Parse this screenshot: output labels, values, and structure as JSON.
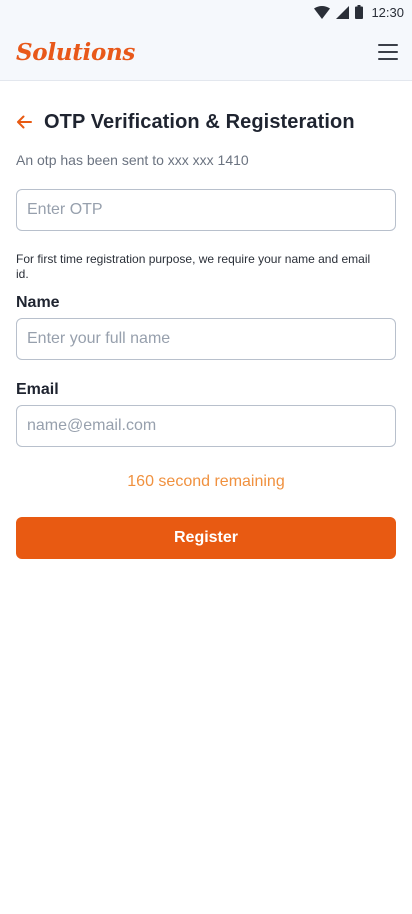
{
  "status_bar": {
    "time": "12:30",
    "icons": [
      "wifi-icon",
      "signal-icon",
      "battery-icon"
    ]
  },
  "app_bar": {
    "brand": "Solutions",
    "menu_icon": "hamburger-menu-icon"
  },
  "page": {
    "back_icon": "arrow-left-icon",
    "title": "OTP Verification & Registeration",
    "otp_info": "An otp has been sent to xxx xxx 1410"
  },
  "form": {
    "otp_placeholder": "Enter OTP",
    "otp_value": "",
    "registration_note": "For first time registration purpose, we require your name and email id.",
    "name_label": "Name",
    "name_placeholder": "Enter your full name",
    "name_value": "",
    "email_label": "Email",
    "email_placeholder": "name@email.com",
    "email_value": "",
    "timer_text": "160 second remaining",
    "register_label": "Register"
  },
  "colors": {
    "accent": "#e85a12",
    "timer": "#f0913f",
    "app_bar_bg": "#f5f8fc"
  }
}
